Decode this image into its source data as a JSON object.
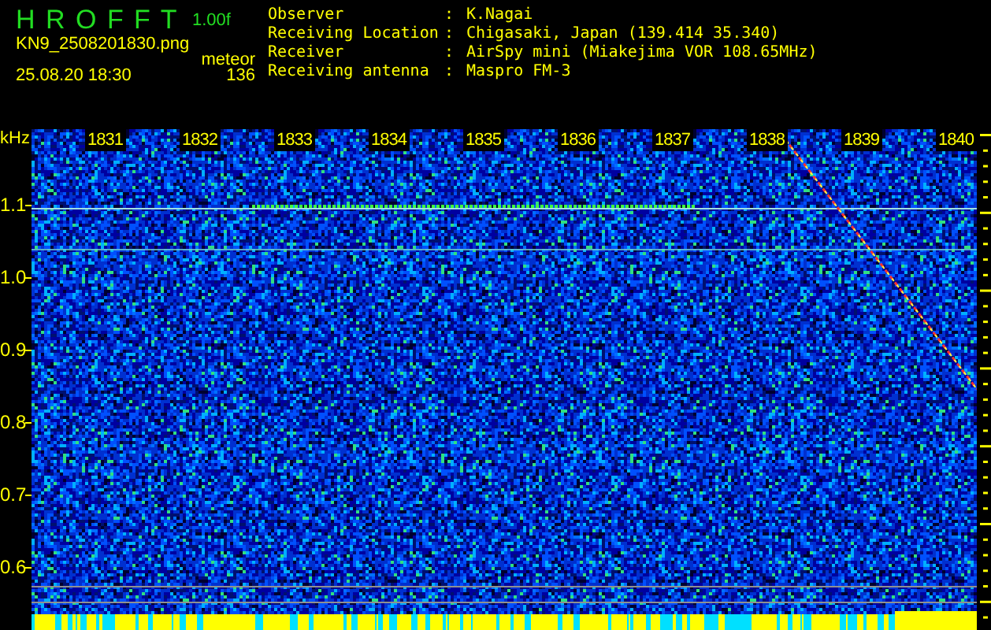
{
  "header": {
    "app_title": "H R O F F T",
    "version": "1.00f",
    "filename": "KN9_2508201830.png",
    "mode": "meteor",
    "count": "136",
    "datetime": "25.08.20 18:30"
  },
  "info": [
    {
      "label": "Observer",
      "separator": ":",
      "value": "K.Nagai"
    },
    {
      "label": "Receiving Location",
      "separator": ":",
      "value": "Chigasaki, Japan (139.414 35.340)"
    },
    {
      "label": "Receiver",
      "separator": ":",
      "value": "AirSpy mini (Miakejima VOR 108.65MHz)"
    },
    {
      "label": "Receiving antenna",
      "separator": ":",
      "value": "Maspro FM-3"
    }
  ],
  "spectrogram": {
    "unit": "kHz",
    "freq_labels": [
      "1.1",
      "1.0",
      "0.9",
      "0.8",
      "0.7",
      "0.6"
    ],
    "time_labels": [
      "1831",
      "1832",
      "1833",
      "1834",
      "1835",
      "1836",
      "1837",
      "1838",
      "1839",
      "1840"
    ]
  }
}
